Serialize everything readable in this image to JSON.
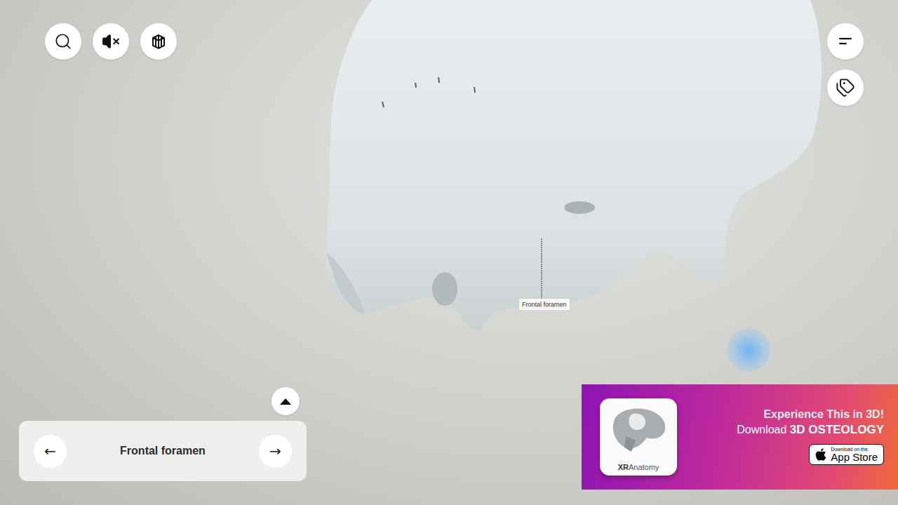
{
  "viewer": {
    "annotation": {
      "label": "Frontal foramen"
    }
  },
  "sound": {
    "muted": true
  },
  "navigator": {
    "prev": "←",
    "title": "Frontal foramen",
    "next": "→"
  },
  "promo": {
    "headline": "Experience This in 3D!",
    "cta_prefix": "Download",
    "app_name": "3D OSTEOLOGY",
    "app_icon_label": {
      "brand": "XR",
      "product": "Anatomy"
    },
    "store_badge": {
      "small": "Download on the",
      "large": "App Store"
    }
  }
}
